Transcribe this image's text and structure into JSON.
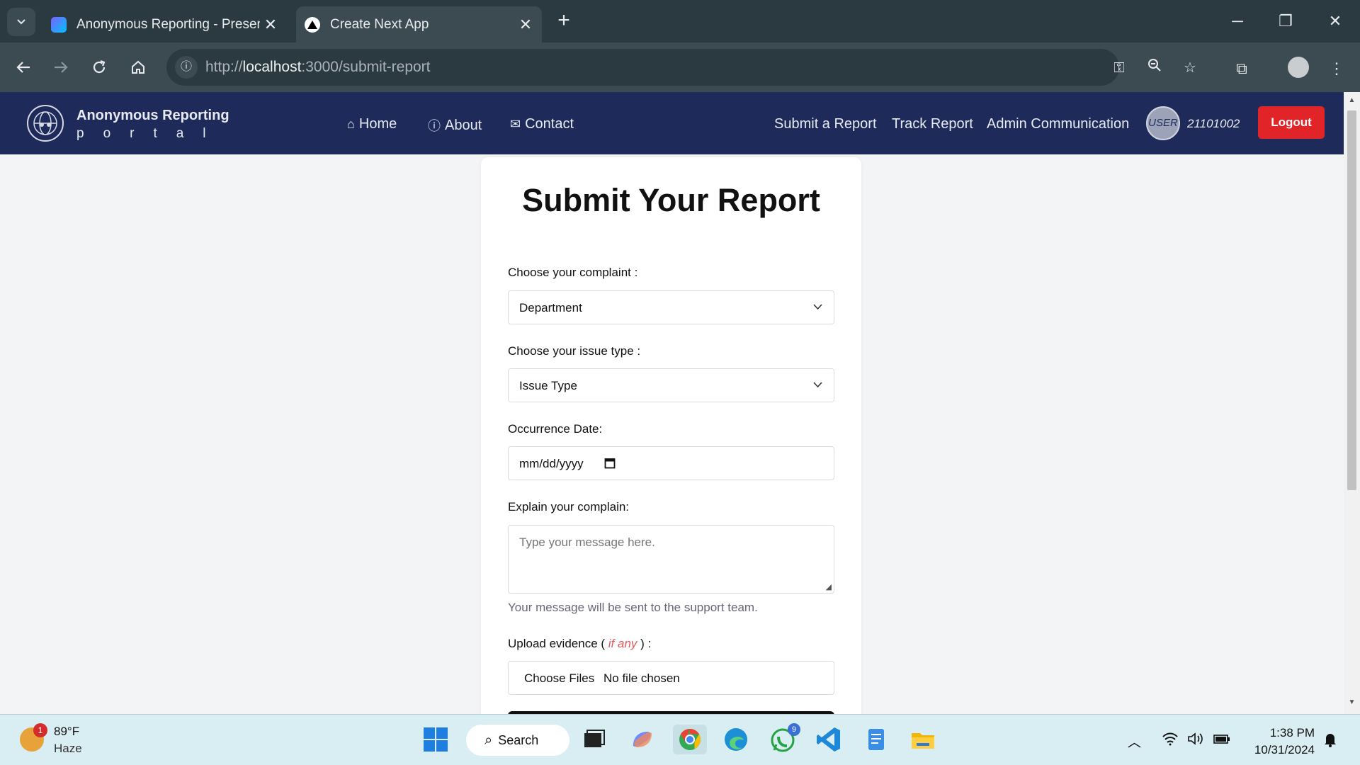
{
  "browser": {
    "tabs": [
      {
        "title": "Anonymous Reporting - Presen",
        "active": false
      },
      {
        "title": "Create Next App",
        "active": true
      }
    ],
    "url_prefix": "http://",
    "url_host": "localhost",
    "url_rest": ":3000/submit-report"
  },
  "site": {
    "brand_title": "Anonymous Reporting",
    "brand_sub": "portal",
    "nav_left": [
      {
        "label": "Home",
        "icon": "home-icon"
      },
      {
        "label": "About",
        "icon": "info-icon"
      },
      {
        "label": "Contact",
        "icon": "envelope-icon"
      }
    ],
    "nav_right": [
      "Submit a Report",
      "Track Report",
      "Admin Communication"
    ],
    "user_badge": "USER",
    "user_id": "21101002",
    "logout_label": "Logout",
    "accent_color": "#1e2a5a",
    "logout_color": "#e02427"
  },
  "form": {
    "title": "Submit Your Report",
    "complaint_label": "Choose your complaint :",
    "complaint_value": "Department",
    "issue_label": "Choose your issue type :",
    "issue_value": "Issue Type",
    "date_label": "Occurrence Date:",
    "date_placeholder": "mm/dd/yyyy",
    "explain_label": "Explain your complain:",
    "message_placeholder": "Type your message here.",
    "helper_text": "Your message will be sent to the support team.",
    "upload_label_start": "Upload evidence (",
    "upload_label_optional": "if any",
    "upload_label_end": ") :",
    "choose_files": "Choose Files",
    "no_file": "No file chosen"
  },
  "taskbar": {
    "weather_temp": "89°F",
    "weather_desc": "Haze",
    "weather_badge": "1",
    "search_label": "Search",
    "whatsapp_badge": "9",
    "time": "1:38 PM",
    "date": "10/31/2024"
  }
}
